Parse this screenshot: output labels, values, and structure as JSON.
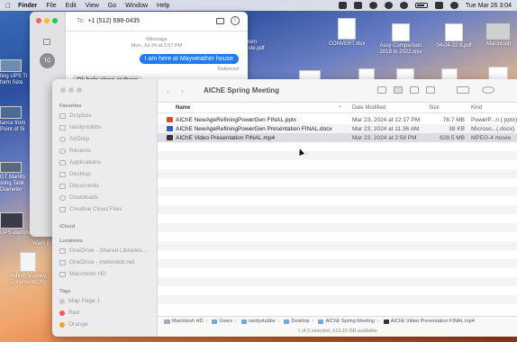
{
  "menubar": {
    "items": [
      "Finder",
      "File",
      "Edit",
      "View",
      "Go",
      "Window",
      "Help"
    ],
    "clock": "Tue Mar 26  3:04"
  },
  "desktop_icons": {
    "left_partial_1": "ting UPS Tr\nform Size",
    "left_partial_2": "tance from\nPoint of Si",
    "left_partial_3": "GT Manifo\nsting Tank\nDiameter",
    "left_partial_4": "UPS identifiers",
    "left_partial_5": "Warri li",
    "zip_label": "Ashish Massey\nDocuments.zip",
    "top_1": "stern\nuote.pdf",
    "top_2": "CONVERT.xlsx",
    "top_3": "Assy Comparison\n2018 to 2022.xlsx",
    "top_4": "04-04-22 8.pdf",
    "top_5": "Macintosh"
  },
  "messages": {
    "to_label": "To:",
    "to_number": "+1 (512) 698-0435",
    "avatar_initials": "TC",
    "meta_line1": "iMessage",
    "meta_line2": "Mon, Jul 24 at 3:57 PM",
    "sent_bubble": "I am here at Mayweather house",
    "delivered": "Delivered",
    "received_bubble": "Ok help close at there"
  },
  "finder": {
    "title": "AIChE Spring Meeting",
    "sidebar": {
      "favorites_header": "Favorites",
      "favorites": [
        "Dropbox",
        "randystubbs",
        "AirDrop",
        "Recents",
        "Applications",
        "Desktop",
        "Documents",
        "Downloads",
        "Creative Cloud Files"
      ],
      "icloud_header": "iCloud",
      "locations_header": "Locations",
      "locations": [
        "OneDrive - Shared Libraries...",
        "OneDrive - meterskid.net",
        "Macintosh HD"
      ],
      "tags_header": "Tags",
      "tags": [
        {
          "label": "Map Page 1",
          "color": "#c8c8c8"
        },
        {
          "label": "Red",
          "color": "#f25a55"
        },
        {
          "label": "Orange",
          "color": "#f5a030"
        }
      ]
    },
    "columns": {
      "name": "Name",
      "date": "Date Modified",
      "size": "Size",
      "kind": "Kind"
    },
    "files": [
      {
        "name": "AIChE NewAgeRefiningPowerGen FINAL.pptx",
        "date": "Mar 23, 2024 at 12:17 PM",
        "size": "76.7 MB",
        "kind": "PowerP...n (.pptx)",
        "icon_color": "#d2502d"
      },
      {
        "name": "AIChE NewAgeRefiningPowerGen Presentation FINAL.docx",
        "date": "Mar 23, 2024 at 11:36 AM",
        "size": "38 KB",
        "kind": "Microso...(.docx)",
        "icon_color": "#2b5fb8"
      },
      {
        "name": "AIChE Video Presentation FINAL.mp4",
        "date": "Mar 23, 2024 at 2:58 PM",
        "size": "628.5 MB",
        "kind": "MPEG-4 movie",
        "icon_color": "#333333"
      }
    ],
    "path": [
      "Macintosh HD",
      "Users",
      "randystubbs",
      "Desktop",
      "AIChE Spring Meeting",
      "AIChE Video Presentation FINAL.mp4"
    ],
    "status": "1 of 3 selected, 613.15 GB available"
  }
}
